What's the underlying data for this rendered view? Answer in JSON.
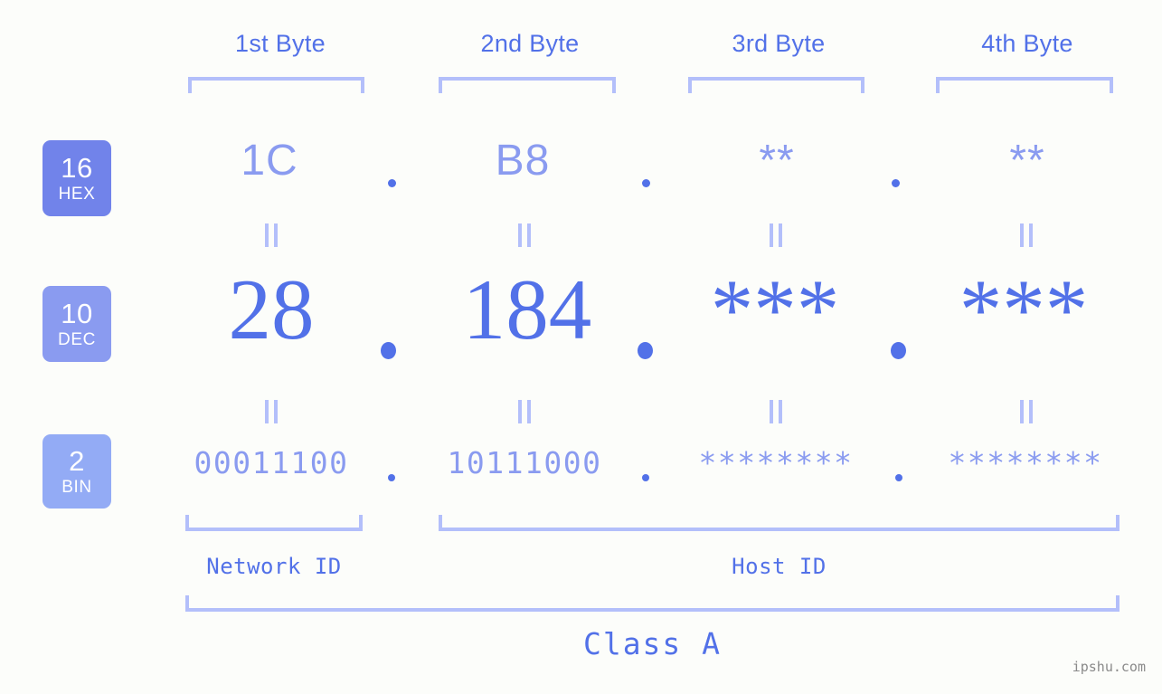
{
  "background_color": "#fcfdfa",
  "accent_color": "#5271e8",
  "light_accent_color": "#8a9bf0",
  "bracket_color": "#b3bffa",
  "byte_headers": [
    {
      "label": "1st Byte"
    },
    {
      "label": "2nd Byte"
    },
    {
      "label": "3rd Byte"
    },
    {
      "label": "4th Byte"
    }
  ],
  "rows": [
    {
      "base_number": "16",
      "base_name": "HEX",
      "badge_color": "#7183ea",
      "values": [
        "1C",
        "B8",
        "**",
        "**"
      ]
    },
    {
      "base_number": "10",
      "base_name": "DEC",
      "badge_color": "#8a9bf0",
      "values": [
        "28",
        "184",
        "***",
        "***"
      ]
    },
    {
      "base_number": "2",
      "base_name": "BIN",
      "badge_color": "#93abf5",
      "values": [
        "00011100",
        "10111000",
        "********",
        "********"
      ]
    }
  ],
  "separator": ".",
  "segments": {
    "network_id": "Network ID",
    "host_id": "Host ID"
  },
  "class_label": "Class A",
  "watermark": "ipshu.com",
  "chart_data": {
    "type": "table",
    "title": "IPv4 address byte breakdown",
    "columns": [
      "1st Byte",
      "2nd Byte",
      "3rd Byte",
      "4th Byte"
    ],
    "rows": [
      {
        "base": "16 HEX",
        "cells": [
          "1C",
          "B8",
          "**",
          "**"
        ]
      },
      {
        "base": "10 DEC",
        "cells": [
          "28",
          "184",
          "***",
          "***"
        ]
      },
      {
        "base": "2 BIN",
        "cells": [
          "00011100",
          "10111000",
          "********",
          "********"
        ]
      }
    ],
    "network_id_bytes": 1,
    "host_id_bytes": 3,
    "address_class": "Class A"
  }
}
